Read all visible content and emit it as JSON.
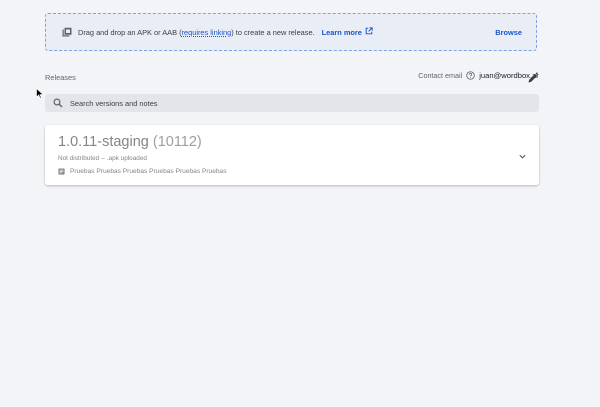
{
  "dropzone": {
    "text_before": "Drag and drop an APK or AAB (",
    "link_text": "requires linking",
    "text_after": ") to create a new release.",
    "learn_more": "Learn more",
    "browse": "Browse"
  },
  "releases": {
    "label": "Releases",
    "contact_label": "Contact email",
    "contact_email": "juan@wordbox.ai"
  },
  "search": {
    "placeholder": "Search versions and notes",
    "value": ""
  },
  "release_card": {
    "version": "1.0.11-staging",
    "build": "(10112)",
    "status": "Not distributed",
    "separator": "–",
    "upload_status": ".apk uploaded",
    "notes": "Pruebas Pruebas Pruebas Pruebas Pruebas Pruebas"
  },
  "colors": {
    "accent": "#1a56c9",
    "background": "#f3f4f7",
    "dropzone_bg": "#e8edf6",
    "dropzone_border": "#7da2e3"
  }
}
